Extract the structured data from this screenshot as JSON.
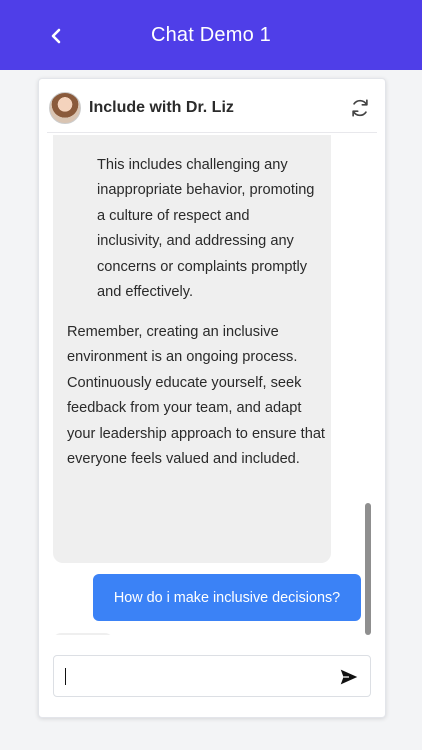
{
  "app_bar": {
    "title": "Chat Demo 1",
    "background": "#4f3ee8",
    "back_icon": "chevron-left-icon"
  },
  "chat": {
    "header": {
      "title": "Include with Dr. Liz",
      "avatar": "avatar",
      "refresh_icon": "refresh-icon"
    },
    "messages": [
      {
        "role": "bot",
        "paragraphs": [
          "This includes challenging any inappropriate behavior, promoting a culture of respect and inclusivity, and addressing any concerns or complaints promptly and effectively.",
          "Remember, creating an inclusive environment is an ongoing process. Continuously educate yourself, seek feedback from your team, and adapt your leadership approach to ensure that everyone feels valued and included."
        ]
      },
      {
        "role": "user",
        "text": "How do i make inclusive decisions?",
        "color": "#3b82f6"
      },
      {
        "role": "bot",
        "typing": true
      }
    ],
    "input": {
      "value": "",
      "placeholder": ""
    },
    "send_icon": "send-icon"
  }
}
